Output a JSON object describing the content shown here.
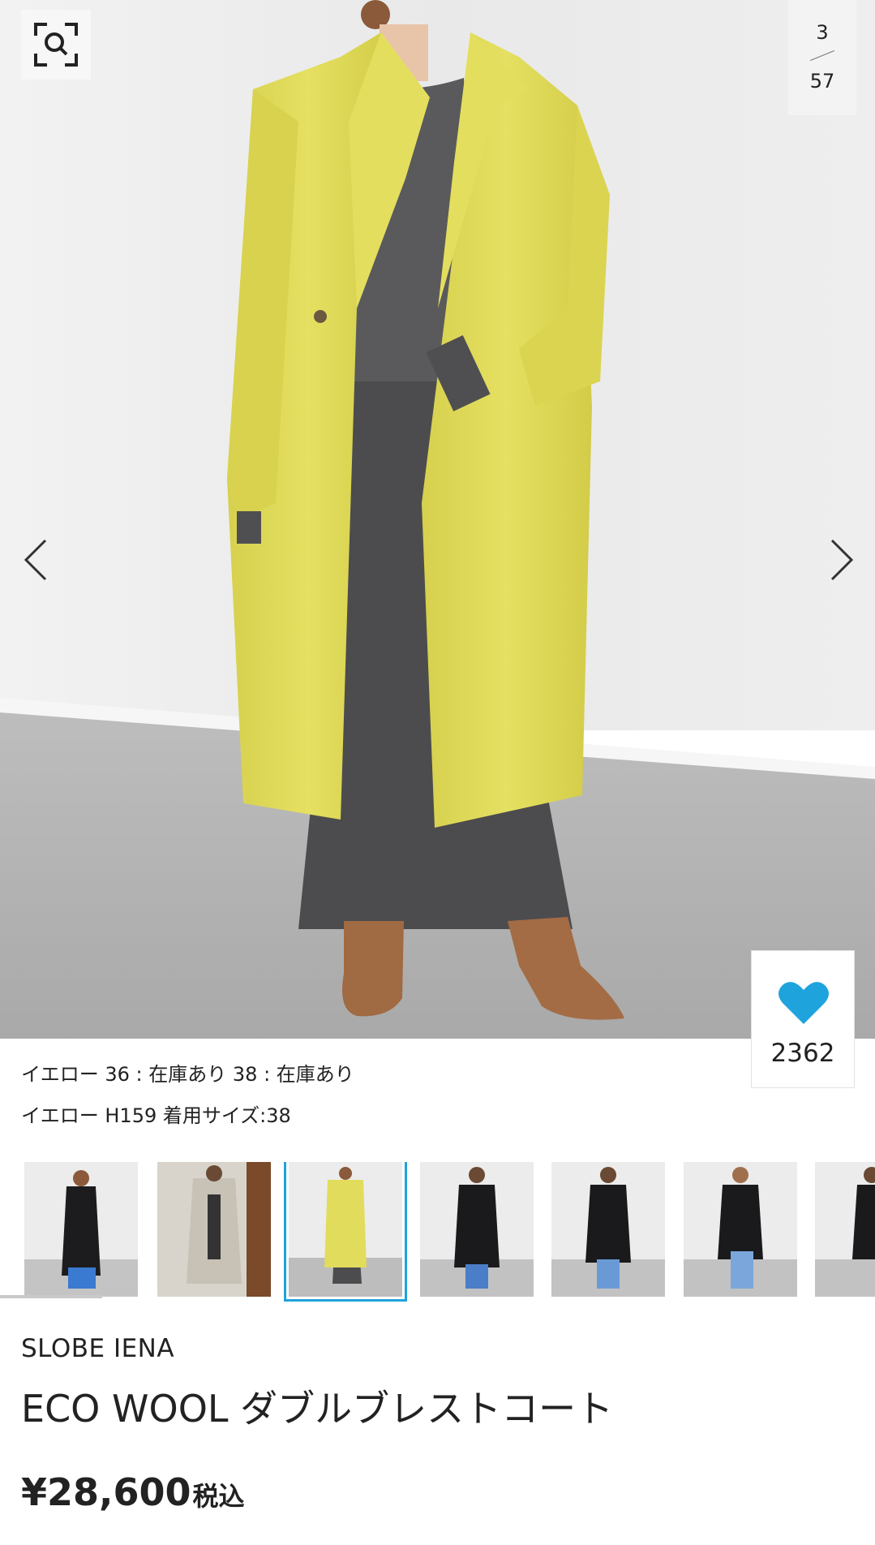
{
  "gallery": {
    "current": "3",
    "total": "57"
  },
  "favorite": {
    "count": "2362"
  },
  "stock_lines": [
    "イエロー 36 : 在庫あり 38 : 在庫あり",
    "イエロー H159 着用サイズ:38"
  ],
  "product": {
    "brand": "SLOBE IENA",
    "title": "ECO WOOL ダブルブレストコート",
    "price": "¥28,600",
    "tax_label": "税込"
  },
  "colors": {
    "accent": "#1fa3dc",
    "coat": "#e2dc5c"
  },
  "icons": {
    "zoom": "zoom-search-icon",
    "prev": "chevron-left-icon",
    "next": "chevron-right-icon",
    "favorite": "heart-icon"
  }
}
